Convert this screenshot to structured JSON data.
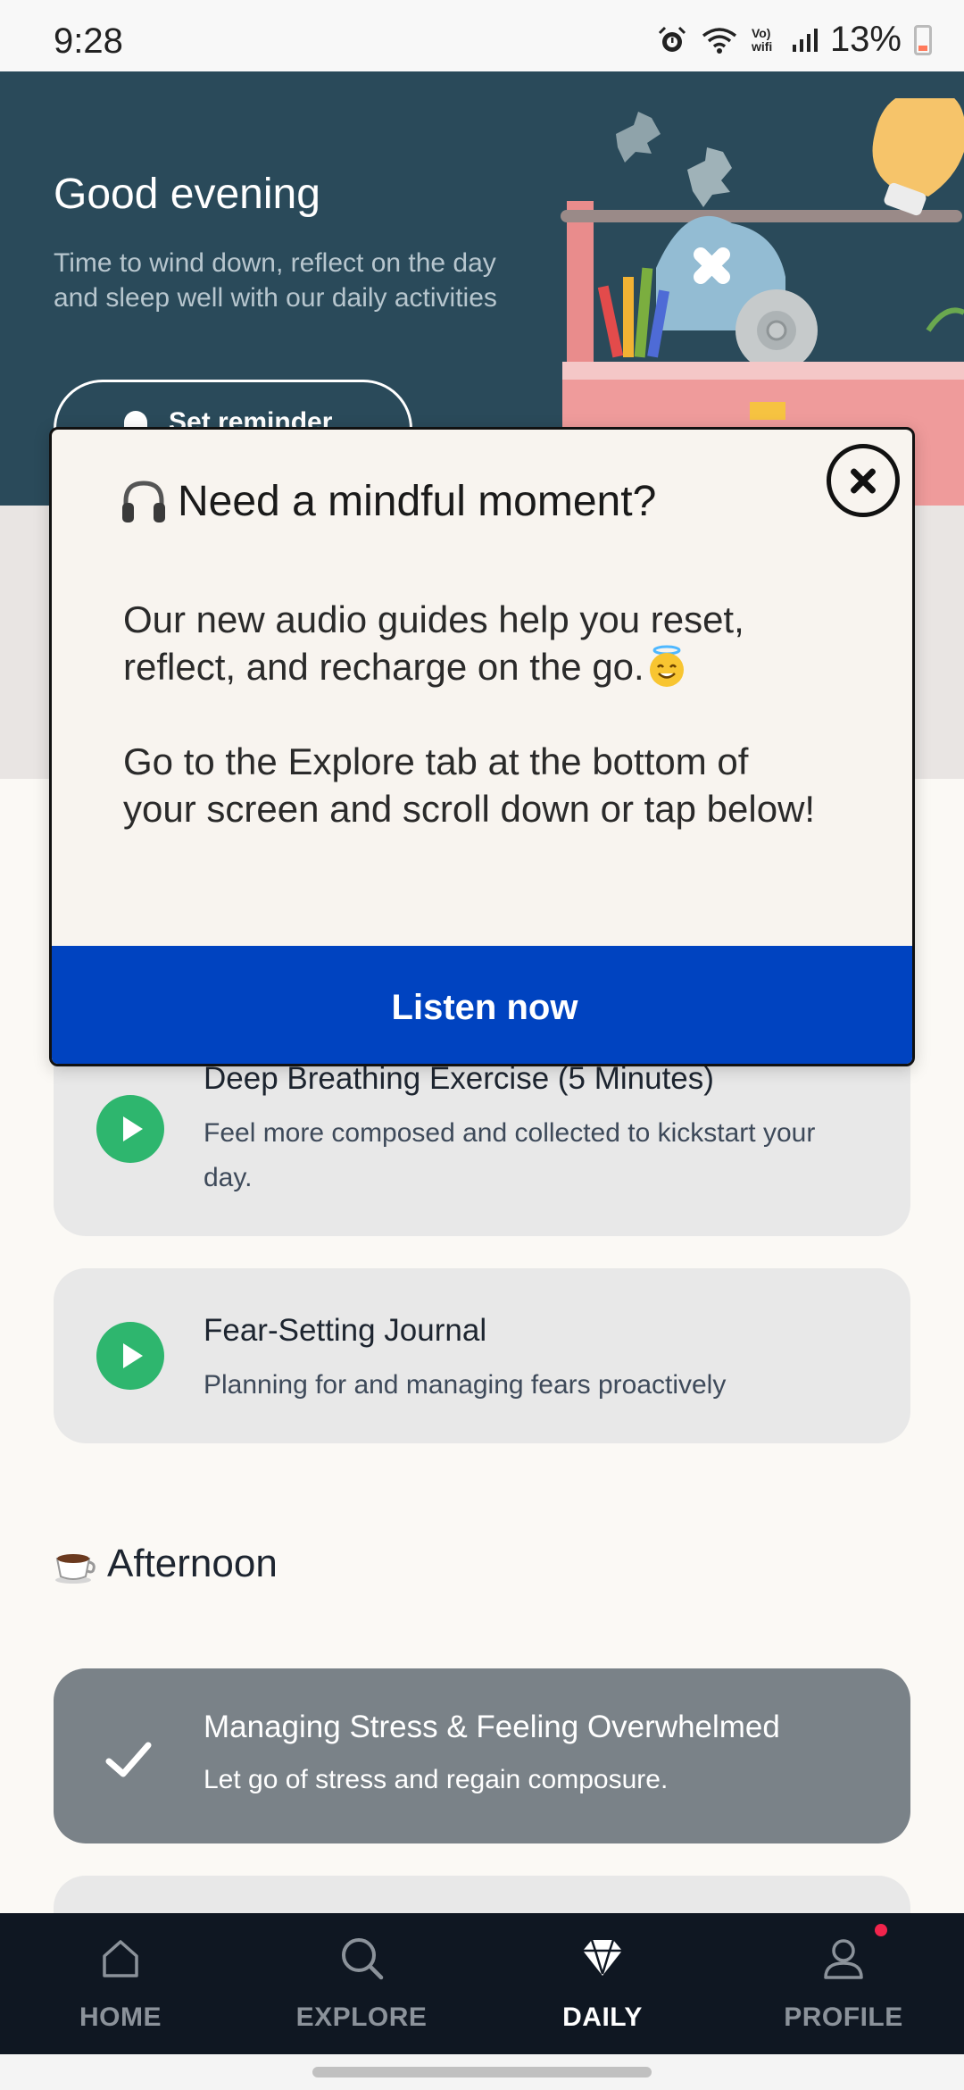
{
  "status_bar": {
    "time": "9:28",
    "battery": "13%",
    "network_label": "Vo) wifi"
  },
  "header": {
    "greeting": "Good evening",
    "subtitle": "Time to wind down, reflect on the day and sleep well with our daily activities",
    "reminder_button": "Set reminder"
  },
  "activities": [
    {
      "title": "Deep Breathing Exercise (5 Minutes)",
      "description": "Feel more composed and collected to kickstart your day.",
      "completed": false
    },
    {
      "title": "Fear-Setting Journal",
      "description": "Planning for and managing fears proactively",
      "completed": false
    }
  ],
  "afternoon": {
    "section_title": "Afternoon",
    "activities": [
      {
        "title": "Managing Stress & Feeling Overwhelmed",
        "description": "Let go of stress and regain composure.",
        "completed": true
      }
    ]
  },
  "modal": {
    "title": "Need a mindful moment?",
    "body_line1": "Our new audio guides help you reset, reflect, and recharge on the go.",
    "body_line2": "Go to the Explore tab at the bottom of your screen and scroll down or tap below!",
    "cta": "Listen now",
    "icons": [
      "headphones-icon",
      "smiling-halo-icon",
      "close-icon"
    ]
  },
  "nav": {
    "items": [
      {
        "label": "HOME",
        "icon": "home-icon",
        "active": false
      },
      {
        "label": "EXPLORE",
        "icon": "search-icon",
        "active": false
      },
      {
        "label": "DAILY",
        "icon": "diamond-icon",
        "active": true
      },
      {
        "label": "PROFILE",
        "icon": "profile-icon",
        "active": false,
        "notification": true
      }
    ]
  },
  "colors": {
    "header_bg": "#2a4a5a",
    "cta_blue": "#0043c0",
    "play_green": "#2eb66e",
    "nav_bg": "#0f1722",
    "done_card": "#7a8288",
    "notification_dot": "#f2244c"
  }
}
